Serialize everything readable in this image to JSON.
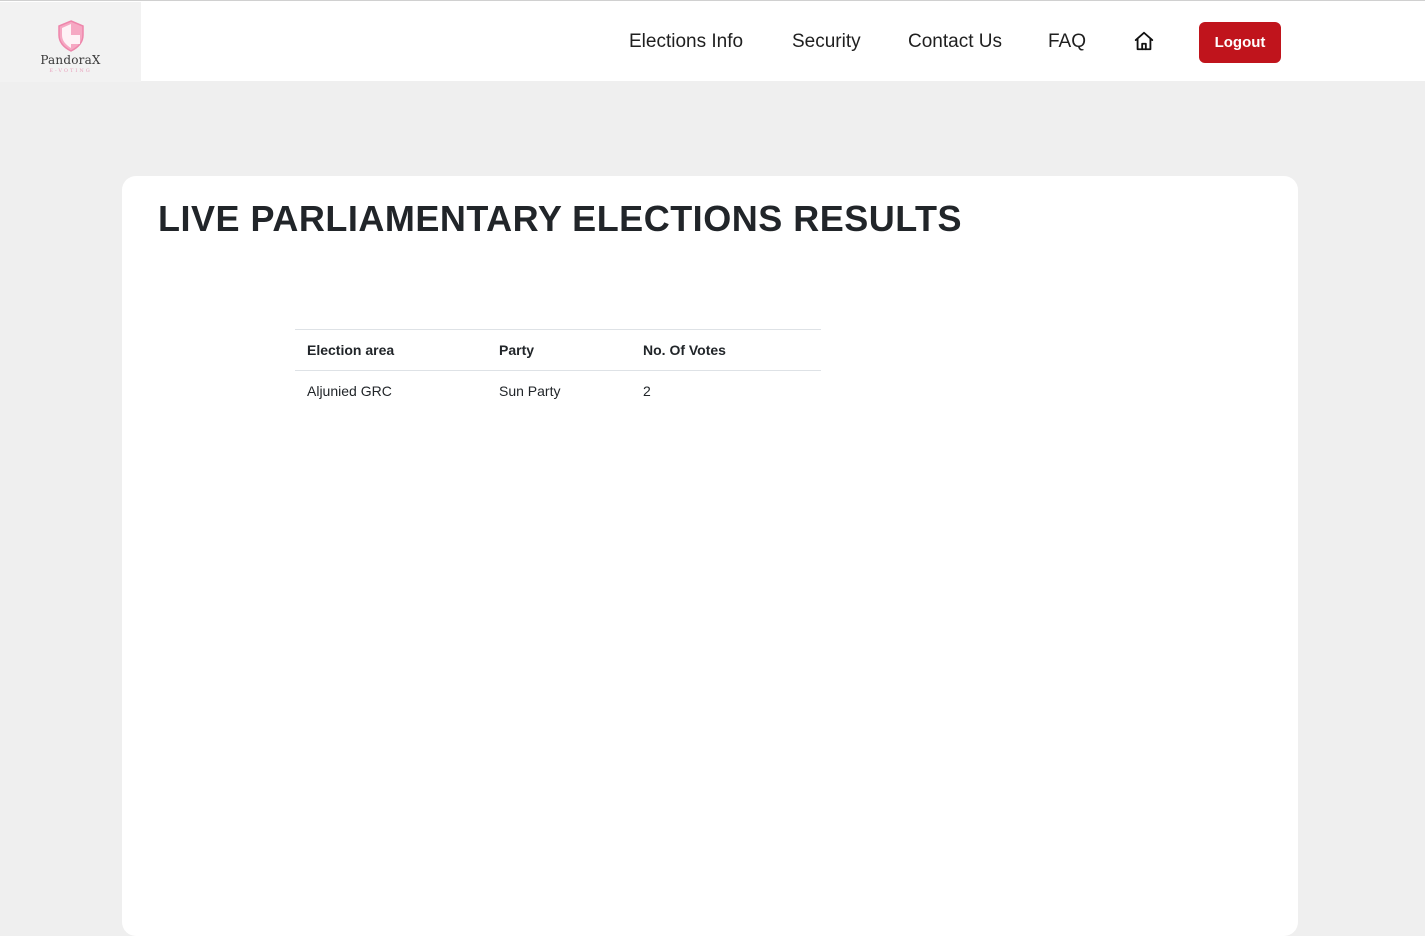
{
  "brand": {
    "name": "PandoraX",
    "tagline": "E-VOTING",
    "logo_icon": "shield-icon",
    "logo_color": "#f28db0"
  },
  "nav": {
    "links": [
      "Elections Info",
      "Security",
      "Contact Us",
      "FAQ"
    ],
    "home_icon": "home-icon",
    "logout_label": "Logout",
    "logout_color": "#c0141c"
  },
  "main": {
    "title": "LIVE PARLIAMENTARY ELECTIONS RESULTS",
    "table": {
      "headers": [
        "Election area",
        "Party",
        "No. Of Votes"
      ],
      "rows": [
        [
          "Aljunied GRC",
          "Sun Party",
          "2"
        ]
      ]
    }
  }
}
